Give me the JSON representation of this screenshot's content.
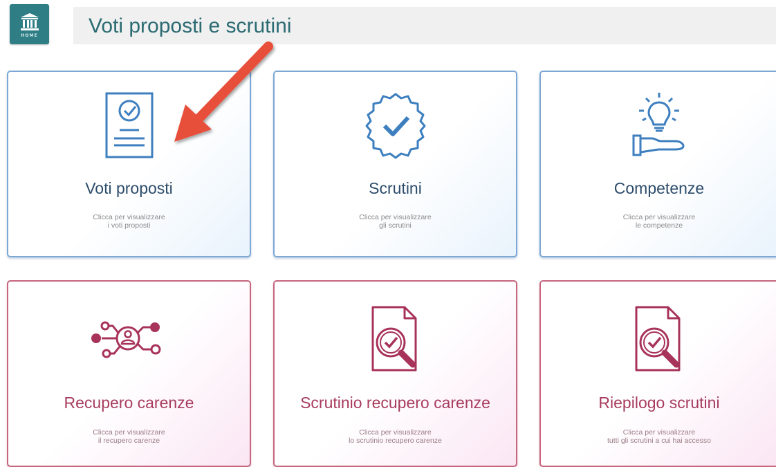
{
  "header": {
    "home_label": "HOME",
    "title": "Voti proposti e scrutini"
  },
  "cards": [
    {
      "title": "Voti proposti",
      "sub1": "Clicca per visualizzare",
      "sub2": "i voti proposti",
      "icon": "document-check-icon",
      "color": "#3d7fbf"
    },
    {
      "title": "Scrutini",
      "sub1": "Clicca per visualizzare",
      "sub2": "gli scrutini",
      "icon": "badge-check-icon",
      "color": "#3d7fbf"
    },
    {
      "title": "Competenze",
      "sub1": "Clicca per visualizzare",
      "sub2": "le competenze",
      "icon": "lightbulb-hand-icon",
      "color": "#3d7fbf"
    },
    {
      "title": "Recupero carenze",
      "sub1": "Clicca per visualizzare",
      "sub2": "il recupero carenze",
      "icon": "network-user-icon",
      "color": "#a8335a"
    },
    {
      "title": "Scrutinio recupero carenze",
      "sub1": "Clicca per visualizzare",
      "sub2": "lo scrutinio recupero carenze",
      "icon": "document-search-check-icon",
      "color": "#a8335a"
    },
    {
      "title": "Riepilogo scrutini",
      "sub1": "Clicca per visualizzare",
      "sub2": "tutti gli scrutini a cui hai accesso",
      "icon": "document-search-check-icon",
      "color": "#a8335a"
    }
  ],
  "annotation": {
    "arrow_color": "#e8503a"
  }
}
